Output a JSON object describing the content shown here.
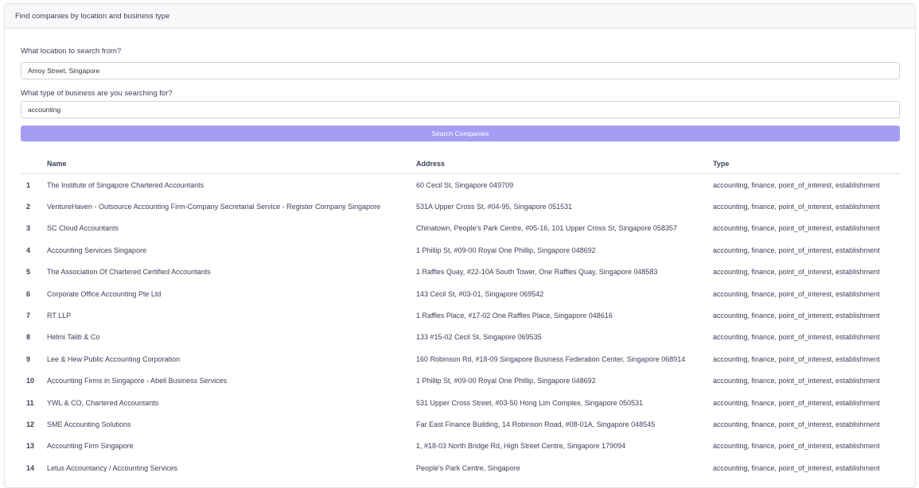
{
  "header": {
    "title": "Find companies by location and business type"
  },
  "form": {
    "location_label": "What location to search from?",
    "location_value": "Amoy Street, Singapore",
    "business_label": "What type of business are you searching for?",
    "business_value": "accounting",
    "search_button": "Search Companies"
  },
  "table": {
    "columns": [
      "",
      "Name",
      "Address",
      "Type"
    ],
    "rows": [
      {
        "num": "1",
        "name": "The Institute of Singapore Chartered Accountants",
        "address": "60 Cecil St, Singapore 049709",
        "type": "accounting, finance, point_of_interest, establishment"
      },
      {
        "num": "2",
        "name": "VentureHaven - Outsource Accounting Firm-Company Secretarial Service - Register Company Singapore",
        "address": "531A Upper Cross St, #04-95, Singapore 051531",
        "type": "accounting, finance, point_of_interest, establishment"
      },
      {
        "num": "3",
        "name": "SC Cloud Accountants",
        "address": "Chinatown, People's Park Centre, #05-16, 101 Upper Cross St, Singapore 058357",
        "type": "accounting, finance, point_of_interest, establishment"
      },
      {
        "num": "4",
        "name": "Accounting Services Singapore",
        "address": "1 Phillip St, #09-00 Royal One Phillip, Singapore 048692",
        "type": "accounting, finance, point_of_interest, establishment"
      },
      {
        "num": "5",
        "name": "The Association Of Chartered Certified Accountants",
        "address": "1 Raffles Quay, #22-10A South Tower, One Raffles Quay, Singapore 048583",
        "type": "accounting, finance, point_of_interest, establishment"
      },
      {
        "num": "6",
        "name": "Corporate Office Accounting Pte Ltd",
        "address": "143 Cecil St, #03-01, Singapore 069542",
        "type": "accounting, finance, point_of_interest, establishment"
      },
      {
        "num": "7",
        "name": "RT LLP",
        "address": "1 Raffles Place, #17-02 One Raffles Place, Singapore 048616",
        "type": "accounting, finance, point_of_interest, establishment"
      },
      {
        "num": "8",
        "name": "Helmi Talib & Co",
        "address": "133 #15-02 Cecil St, Singapore 069535",
        "type": "accounting, finance, point_of_interest, establishment"
      },
      {
        "num": "9",
        "name": "Lee & Hew Public Accounting Corporation",
        "address": "160 Robinson Rd, #18-09 Singapore Business Federation Center, Singapore 068914",
        "type": "accounting, finance, point_of_interest, establishment"
      },
      {
        "num": "10",
        "name": "Accounting Firms in Singapore - Abell Business Services",
        "address": "1 Phillip St, #09-00 Royal One Phillip, Singapore 048692",
        "type": "accounting, finance, point_of_interest, establishment"
      },
      {
        "num": "11",
        "name": "YWL & CO, Chartered Accountants",
        "address": "531 Upper Cross Street, #03-50 Hong Lim Complex, Singapore 050531",
        "type": "accounting, finance, point_of_interest, establishment"
      },
      {
        "num": "12",
        "name": "SME Accounting Solutions",
        "address": "Far East Finance Building, 14 Robinson Road, #08-01A, Singapore 048545",
        "type": "accounting, finance, point_of_interest, establishment"
      },
      {
        "num": "13",
        "name": "Accounting Firm Singapore",
        "address": "1, #18-03 North Bridge Rd, High Street Centre, Singapore 179094",
        "type": "accounting, finance, point_of_interest, establishment"
      },
      {
        "num": "14",
        "name": "Letus Accountancy / Accounting Services",
        "address": "People's Park Centre, Singapore",
        "type": "accounting, finance, point_of_interest, establishment"
      }
    ]
  }
}
